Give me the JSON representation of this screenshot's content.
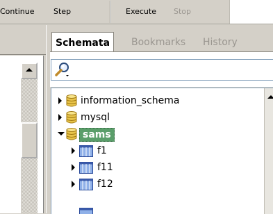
{
  "toolbar": {
    "continue_label": "Continue",
    "step_label": "Step",
    "execute_label": "Execute",
    "stop_label": "Stop"
  },
  "tabs": [
    {
      "label": "Schemata",
      "active": true
    },
    {
      "label": "Bookmarks",
      "active": false
    },
    {
      "label": "History",
      "active": false
    }
  ],
  "search": {
    "placeholder": "",
    "icon": "magnifier-icon"
  },
  "tree": [
    {
      "label": "information_schema",
      "type": "schema",
      "expanded": false,
      "level": 0
    },
    {
      "label": "mysql",
      "type": "schema",
      "expanded": false,
      "level": 0
    },
    {
      "label": "sams",
      "type": "schema",
      "expanded": true,
      "selected": true,
      "level": 0
    },
    {
      "label": "f1",
      "type": "table",
      "expanded": false,
      "level": 1
    },
    {
      "label": "f11",
      "type": "table",
      "expanded": false,
      "level": 1
    },
    {
      "label": "f12",
      "type": "table",
      "expanded": false,
      "level": 1
    }
  ],
  "colors": {
    "selection": "#5a9e6a",
    "db_icon": "#e8c44a",
    "table_icon": "#5577bb",
    "panel_bg": "#d4d0c8"
  }
}
